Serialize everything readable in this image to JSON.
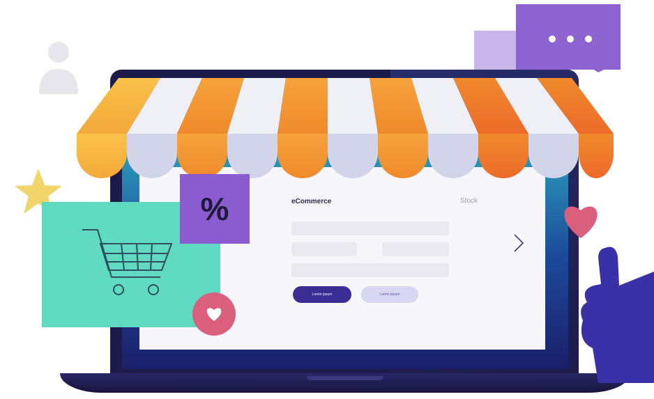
{
  "panel": {
    "title": "eCommerce",
    "stock_label": "Stock",
    "primary_button": "Lorem ipsum",
    "secondary_button": "Lorem ipsum"
  },
  "percent_symbol": "%",
  "colors": {
    "laptop_body": "#1d1b4a",
    "screen_top": "#2fb3c4",
    "cart_card": "#5fd9bf",
    "percent_card": "#8a5cd0",
    "heart": "#d95f7c",
    "chat_bubble": "#8e63d2",
    "thumb_hand": "#3a30a8",
    "star": "#f1d46a",
    "primary_button": "#3b2d94",
    "secondary_button": "#d9d6f1"
  },
  "icons": [
    "user-icon",
    "chat-bubble-icon",
    "shopping-cart-icon",
    "percent-icon",
    "heart-icon",
    "star-icon",
    "thumbs-up-icon",
    "chevron-right-icon"
  ]
}
